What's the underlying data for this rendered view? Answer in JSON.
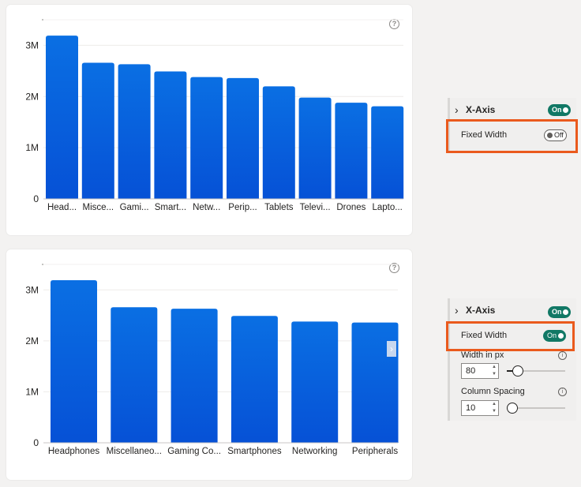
{
  "colors": {
    "bar_top": "#0a6fe3",
    "bar_bottom": "#0651d6",
    "toggle_on": "#117865",
    "highlight": "#ea5a1d"
  },
  "chart_top": {
    "help_icon": "?",
    "chart_data": {
      "type": "bar",
      "title": "",
      "categories": [
        "Head...",
        "Misce...",
        "Gami...",
        "Smart...",
        "Netw...",
        "Perip...",
        "Tablets",
        "Televi...",
        "Drones",
        "Lapto..."
      ],
      "values": [
        3190000,
        2660000,
        2630000,
        2490000,
        2380000,
        2360000,
        2200000,
        1980000,
        1880000,
        1810000
      ],
      "ylim": [
        0,
        3500000
      ],
      "yticks": [
        0,
        1000000,
        2000000,
        3000000
      ],
      "ytick_labels": [
        "0",
        "1M",
        "2M",
        "3M"
      ],
      "grid": true
    }
  },
  "chart_bottom": {
    "help_icon": "?",
    "scroll_arrow": "›",
    "chart_data": {
      "type": "bar",
      "title": "",
      "categories": [
        "Headphones",
        "Miscellaneo...",
        "Gaming Co...",
        "Smartphones",
        "Networking",
        "Peripherals"
      ],
      "values": [
        3190000,
        2660000,
        2630000,
        2490000,
        2380000,
        2360000
      ],
      "ylim": [
        0,
        3500000
      ],
      "yticks": [
        0,
        1000000,
        2000000,
        3000000
      ],
      "ytick_labels": [
        "0",
        "1M",
        "2M",
        "3M"
      ],
      "grid": true
    }
  },
  "panel_top": {
    "section_title": "X-Axis",
    "section_toggle": "On",
    "fixed_width_label": "Fixed Width",
    "fixed_width_toggle": "Off"
  },
  "panel_bottom": {
    "section_title": "X-Axis",
    "section_toggle": "On",
    "fixed_width_label": "Fixed Width",
    "fixed_width_toggle": "On",
    "width_label": "Width in px",
    "width_value": "80",
    "width_slider_level": 0.11,
    "spacing_label": "Column Spacing",
    "spacing_value": "10",
    "spacing_slider_level": 0.0
  }
}
